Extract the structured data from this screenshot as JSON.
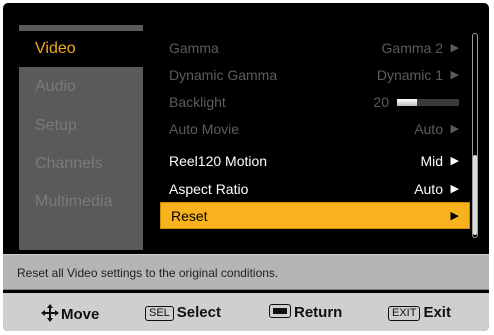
{
  "sidebar": {
    "items": [
      {
        "label": "Video",
        "active": true
      },
      {
        "label": "Audio",
        "active": false
      },
      {
        "label": "Setup",
        "active": false
      },
      {
        "label": "Channels",
        "active": false
      },
      {
        "label": "Multimedia",
        "active": false
      }
    ]
  },
  "menu": {
    "gamma": {
      "label": "Gamma",
      "value": "Gamma 2"
    },
    "dynamic_gamma": {
      "label": "Dynamic Gamma",
      "value": "Dynamic 1"
    },
    "backlight": {
      "label": "Backlight",
      "value": "20",
      "level_fraction": 0.33
    },
    "auto_movie": {
      "label": "Auto Movie",
      "value": "Auto"
    },
    "reel120": {
      "label": "Reel120 Motion",
      "value": "Mid"
    },
    "aspect_ratio": {
      "label": "Aspect Ratio",
      "value": "Auto"
    },
    "reset": {
      "label": "Reset",
      "value": ""
    },
    "arrow_glyph": "▶"
  },
  "description": "Reset all Video settings to the original conditions.",
  "footer": {
    "move": {
      "label": "Move",
      "icon": "dpad-icon"
    },
    "select": {
      "key": "SEL",
      "label": "Select"
    },
    "return": {
      "label": "Return",
      "icon": "return-icon"
    },
    "exit": {
      "key": "EXIT",
      "label": "Exit"
    }
  },
  "colors": {
    "accent": "#f1a91e",
    "selection": "#f7b21d",
    "sidebar_bg": "#5a5a5a",
    "dim_text": "#5c5c5c"
  }
}
